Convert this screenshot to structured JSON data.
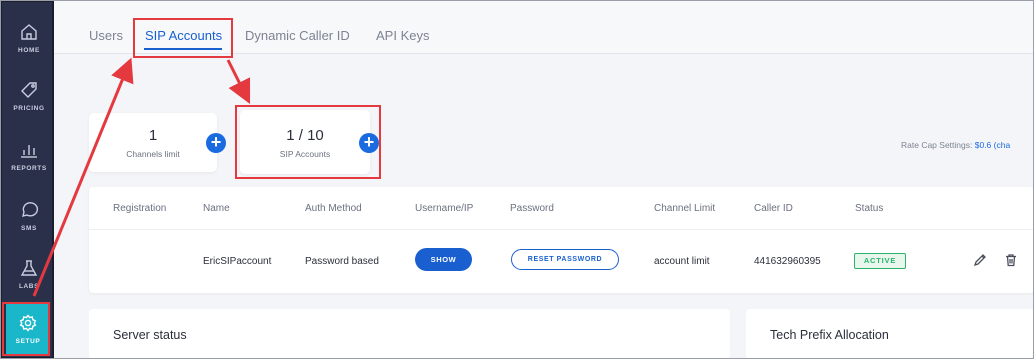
{
  "sidebar": {
    "items": [
      {
        "label": "HOME",
        "icon": "home-icon"
      },
      {
        "label": "PRICING",
        "icon": "tag-icon"
      },
      {
        "label": "REPORTS",
        "icon": "bar-chart-icon"
      },
      {
        "label": "SMS",
        "icon": "chat-bubble-icon"
      },
      {
        "label": "LABS",
        "icon": "flask-icon"
      },
      {
        "label": "SETUP",
        "icon": "gear-icon"
      }
    ],
    "active_color": "#19b7c9"
  },
  "tabs": {
    "items": [
      "Users",
      "SIP Accounts",
      "Dynamic Caller ID",
      "API Keys"
    ],
    "active": "SIP Accounts"
  },
  "stats": {
    "channels": {
      "value": "1",
      "label": "Channels limit"
    },
    "sip": {
      "value": "1 / 10",
      "label": "SIP Accounts"
    },
    "add_symbol": "+"
  },
  "ratecap": {
    "label": "Rate Cap Settings:",
    "value": "$0.6 (cha"
  },
  "table": {
    "headers": [
      "Registration",
      "Name",
      "Auth Method",
      "Username/IP",
      "Password",
      "Channel Limit",
      "Caller ID",
      "Status"
    ],
    "rows": [
      {
        "registration": "",
        "name": "EricSIPaccount",
        "auth_method": "Password based",
        "username_btn": "SHOW",
        "password_btn": "RESET PASSWORD",
        "channel_limit": "account limit",
        "caller_id": "441632960395",
        "status": "ACTIVE"
      }
    ]
  },
  "panels": {
    "server_status": "Server status",
    "tech_prefix": "Tech Prefix Allocation"
  },
  "colors": {
    "accent": "#1a5fd0",
    "annotation": "#e53940",
    "status_active": "#2bb36a"
  }
}
